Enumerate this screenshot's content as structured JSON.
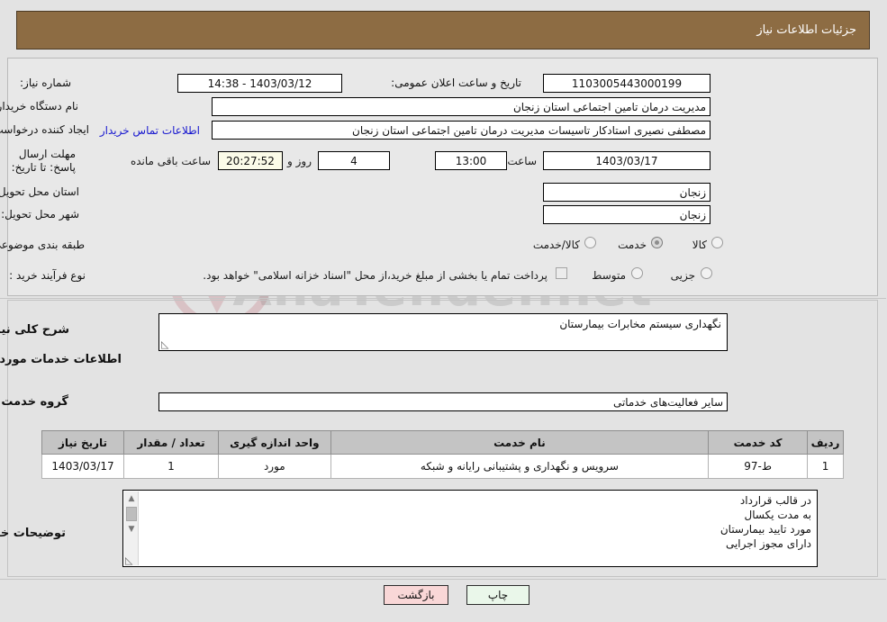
{
  "header": {
    "title": "جزئیات اطلاعات نیاز"
  },
  "top": {
    "need_number_label": "شماره نیاز:",
    "need_number_value": "1103005443000199",
    "public_announce_label": "تاریخ و ساعت اعلان عمومی:",
    "public_announce_value": "1403/03/12 - 14:38",
    "buyer_org_label": "نام دستگاه خریدار:",
    "buyer_org_value": "مدیریت درمان تامین اجتماعی استان زنجان",
    "requester_label": "ایجاد کننده درخواست:",
    "requester_value": "مصطفی نصیری استادکار تاسیسات مدیریت درمان تامین اجتماعی استان زنجان",
    "contact_link": "اطلاعات تماس خریدار",
    "deadline_label": "مهلت ارسال پاسخ: تا تاریخ:",
    "deadline_date": "1403/03/17",
    "hour_label": "ساعت",
    "deadline_time": "13:00",
    "days_remaining": "4",
    "days_word": "روز و",
    "countdown": "20:27:52",
    "remaining_suffix": "ساعت باقی مانده",
    "province_label": "استان محل تحویل:",
    "province_value": "زنجان",
    "city_label": "شهر محل تحویل:",
    "city_value": "زنجان",
    "category_label": "طبقه بندی موضوعی:",
    "category_options": [
      "کالا",
      "خدمت",
      "کالا/خدمت"
    ],
    "category_selected": "خدمت",
    "process_label": "نوع فرآیند خرید :",
    "process_options": [
      "جزیی",
      "متوسط"
    ],
    "process_selected": "",
    "treasury_note": "پرداخت تمام یا بخشی از مبلغ خرید،از محل \"اسناد خزانه اسلامی\" خواهد بود."
  },
  "middle": {
    "general_desc_label": "شرح کلی نیاز:",
    "general_desc_value": "نگهداری سیستم مخابرات بیمارستان",
    "services_heading": "اطلاعات خدمات مورد نیاز",
    "service_group_label": "گروه خدمت:",
    "service_group_value": "سایر فعالیت‌های خدماتی"
  },
  "table": {
    "columns": [
      "ردیف",
      "کد خدمت",
      "نام خدمت",
      "واحد اندازه گیری",
      "تعداد / مقدار",
      "تاریخ نیاز"
    ],
    "rows": [
      {
        "index": "1",
        "code": "ط-97",
        "name": "سرویس و نگهداری و پشتیبانی رایانه و شبکه",
        "unit": "مورد",
        "qty": "1",
        "date": "1403/03/17"
      }
    ]
  },
  "buyer_notes": {
    "label": "توضیحات خریدار:",
    "value": "در قالب قرارداد\nبه مدت یکسال\nمورد تایید بیمارستان\nدارای مجوز اجرایی"
  },
  "footer": {
    "print_label": "چاپ",
    "back_label": "بازگشت"
  },
  "watermark": {
    "text": "AnaTender.net"
  }
}
